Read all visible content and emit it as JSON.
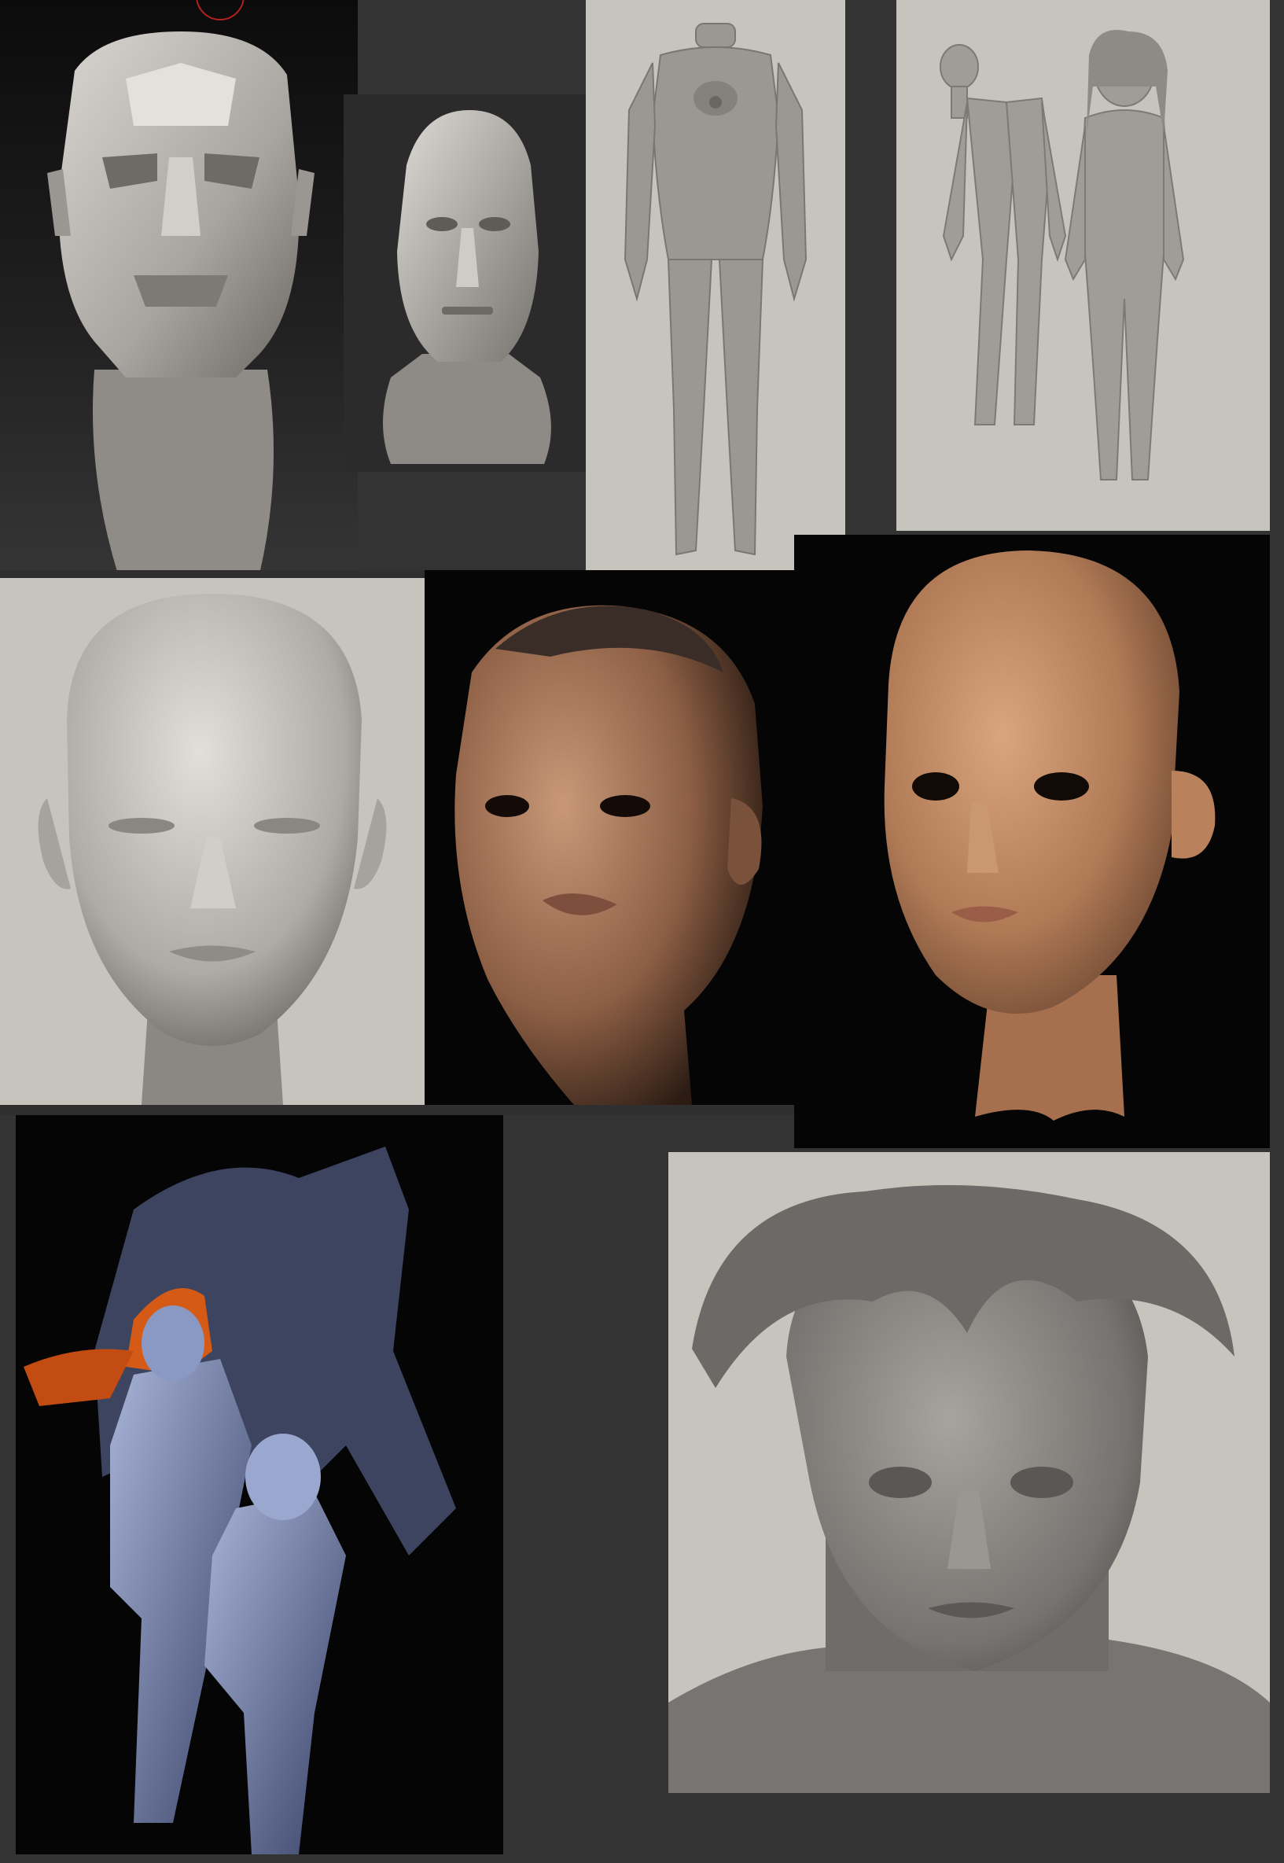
{
  "board": {
    "panels": [
      {
        "subject": "planar-head-sculpt"
      },
      {
        "subject": "male-head-bust"
      },
      {
        "subject": "plugsuit-body-base"
      },
      {
        "subject": "three-figure-lineup"
      },
      {
        "subject": "clay-face-front"
      },
      {
        "subject": "rendered-female-face"
      },
      {
        "subject": "rendered-stylized-face"
      },
      {
        "subject": "character-group-render"
      },
      {
        "subject": "clay-boy-portrait"
      }
    ]
  },
  "colors": {
    "background": "#333333",
    "clay": "#b9b5af",
    "grey_backdrop": "#c7c3bd",
    "skin": "#b98563",
    "hair_accent": "#d45a16",
    "blue_light": "#8a99c4"
  }
}
